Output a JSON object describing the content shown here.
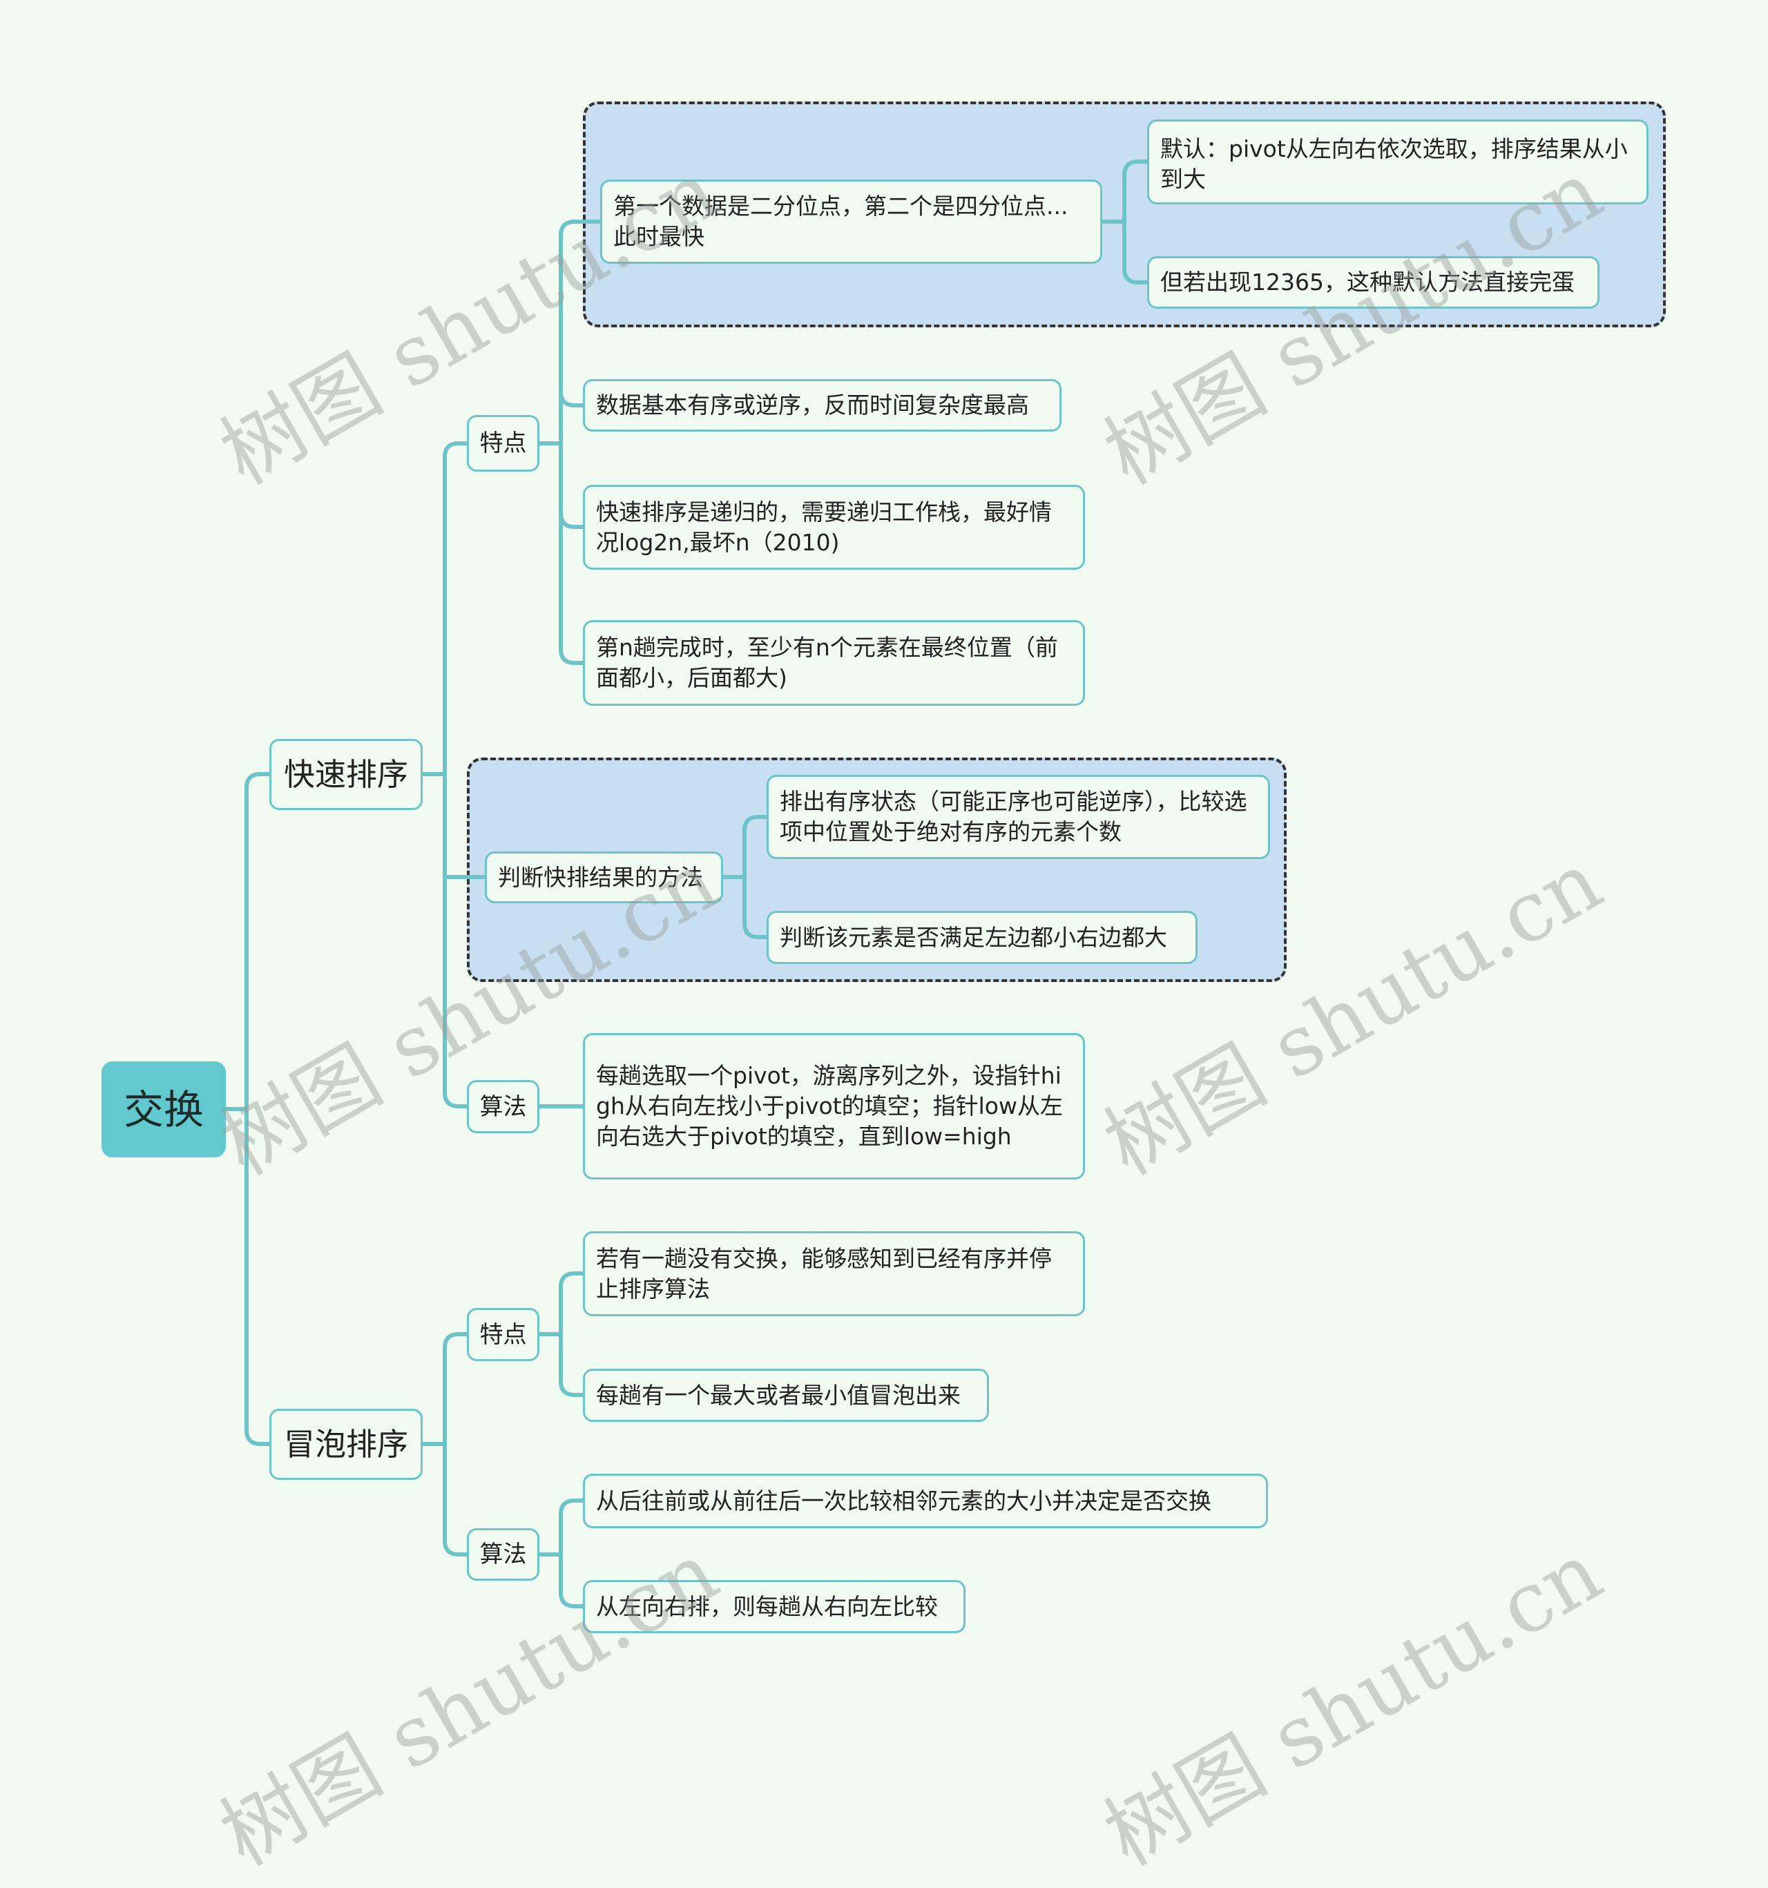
{
  "mindmap": {
    "root": "交换",
    "quicksort": {
      "label": "快速排序",
      "features": {
        "label": "特点",
        "best_case": "第一个数据是二分位点，第二个是四分位点...此时最快",
        "default_note": "默认：pivot从左向右依次选取，排序结果从小到大",
        "default_fail": "但若出现12365，这种默认方法直接完蛋",
        "worst_case": "数据基本有序或逆序，反而时间复杂度最高",
        "recursion": "快速排序是递归的，需要递归工作栈，最好情况log2n,最坏n（2010)",
        "nth_pass": "第n趟完成时，至少有n个元素在最终位置（前面都小，后面都大)"
      },
      "judge": {
        "label": "判断快排结果的方法",
        "exclude_ordered": "排出有序状态（可能正序也可能逆序），比较选项中位置处于绝对有序的元素个数",
        "check_element": "判断该元素是否满足左边都小右边都大"
      },
      "algorithm": {
        "label": "算法",
        "text": "每趟选取一个pivot，游离序列之外，设指针high从右向左找小于pivot的填空；指针low从左向右选大于pivot的填空，直到low=high"
      }
    },
    "bubblesort": {
      "label": "冒泡排序",
      "features": {
        "label": "特点",
        "early_stop": "若有一趟没有交换，能够感知到已经有序并停止排序算法",
        "bubble_out": "每趟有一个最大或者最小值冒泡出来"
      },
      "algorithm": {
        "label": "算法",
        "compare": "从后往前或从前往后一次比较相邻元素的大小并决定是否交换",
        "direction": "从左向右排，则每趟从右向左比较"
      }
    }
  },
  "watermark": "树图 shutu.cn",
  "colors": {
    "background": "#f1faf0",
    "root_fill": "#62cace",
    "connector": "#6cc4c9",
    "group_fill": "#c8dff2",
    "group_border": "#333333"
  }
}
